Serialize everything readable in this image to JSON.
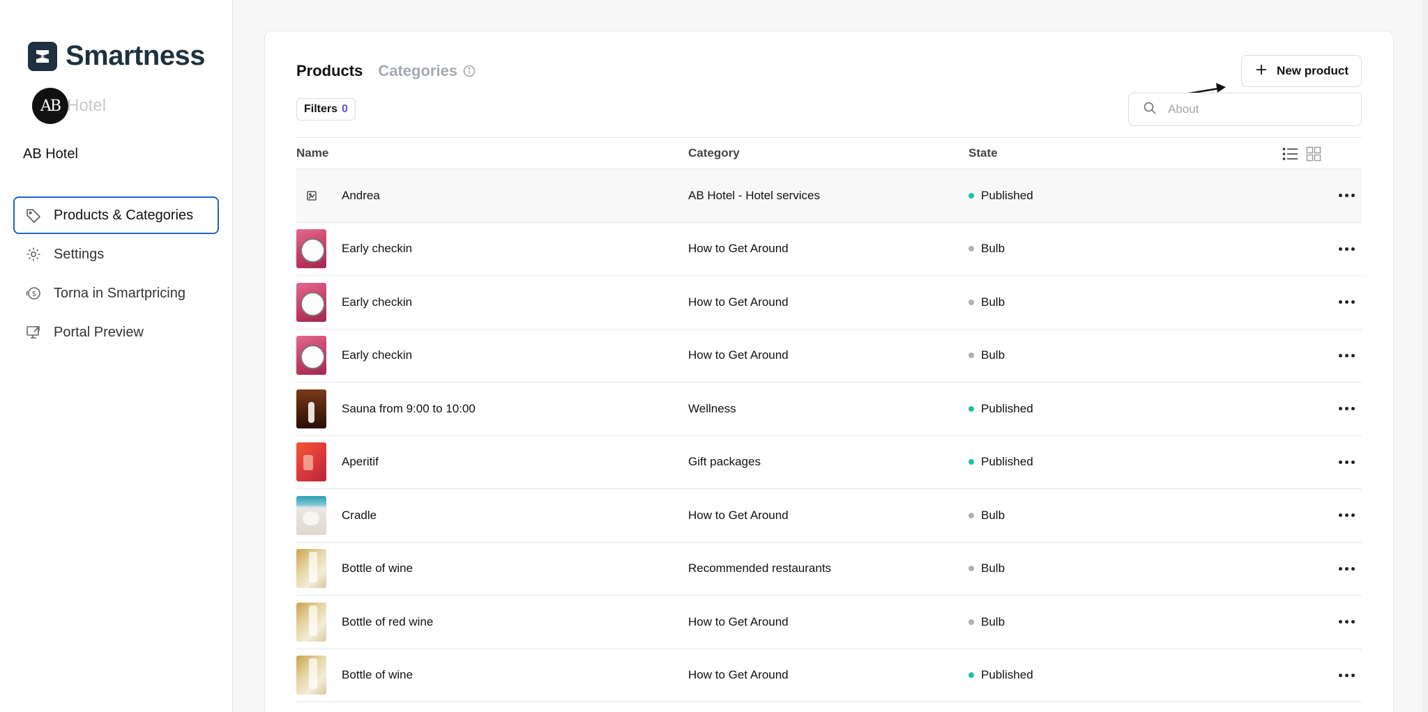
{
  "brand": {
    "name": "Smartness"
  },
  "hotel_logo": {
    "initials": "AB",
    "word": "Hotel"
  },
  "property_name": "AB Hotel",
  "nav": [
    {
      "label": "Products & Categories",
      "icon": "tag-icon",
      "active": true
    },
    {
      "label": "Settings",
      "icon": "gear-icon",
      "active": false
    },
    {
      "label": "Torna in Smartpricing",
      "icon": "dollar-refresh-icon",
      "active": false
    },
    {
      "label": "Portal Preview",
      "icon": "monitor-external-icon",
      "active": false
    }
  ],
  "tabs": {
    "products": "Products",
    "categories": "Categories"
  },
  "new_product_label": "New product",
  "filters": {
    "label": "Filters",
    "count": "0"
  },
  "search": {
    "placeholder": "About"
  },
  "table": {
    "headers": {
      "name": "Name",
      "category": "Category",
      "state": "State"
    },
    "rows": [
      {
        "thumb": "placeholder",
        "name": "Andrea",
        "category": "AB Hotel - Hotel services",
        "state": "Published",
        "status": "published"
      },
      {
        "thumb": "clock",
        "name": "Early checkin",
        "category": "How to Get Around",
        "state": "Bulb",
        "status": "draft"
      },
      {
        "thumb": "clock",
        "name": "Early checkin",
        "category": "How to Get Around",
        "state": "Bulb",
        "status": "draft"
      },
      {
        "thumb": "clock",
        "name": "Early checkin",
        "category": "How to Get Around",
        "state": "Bulb",
        "status": "draft"
      },
      {
        "thumb": "sauna",
        "name": "Sauna from 9:00 to 10:00",
        "category": "Wellness",
        "state": "Published",
        "status": "published"
      },
      {
        "thumb": "aperitif",
        "name": "Aperitif",
        "category": "Gift packages",
        "state": "Published",
        "status": "published"
      },
      {
        "thumb": "cradle",
        "name": "Cradle",
        "category": "How to Get Around",
        "state": "Bulb",
        "status": "draft"
      },
      {
        "thumb": "wine",
        "name": "Bottle of wine",
        "category": "Recommended restaurants",
        "state": "Bulb",
        "status": "draft"
      },
      {
        "thumb": "wine",
        "name": "Bottle of red wine",
        "category": "How to Get Around",
        "state": "Bulb",
        "status": "draft"
      },
      {
        "thumb": "wine",
        "name": "Bottle of wine",
        "category": "How to Get Around",
        "state": "Published",
        "status": "published"
      }
    ]
  },
  "colors": {
    "brand": "#1f3140",
    "active_border": "#1f64c4",
    "published": "#1fbfa7",
    "draft": "#b0b0b0",
    "filter_count": "#6a4bd8"
  }
}
